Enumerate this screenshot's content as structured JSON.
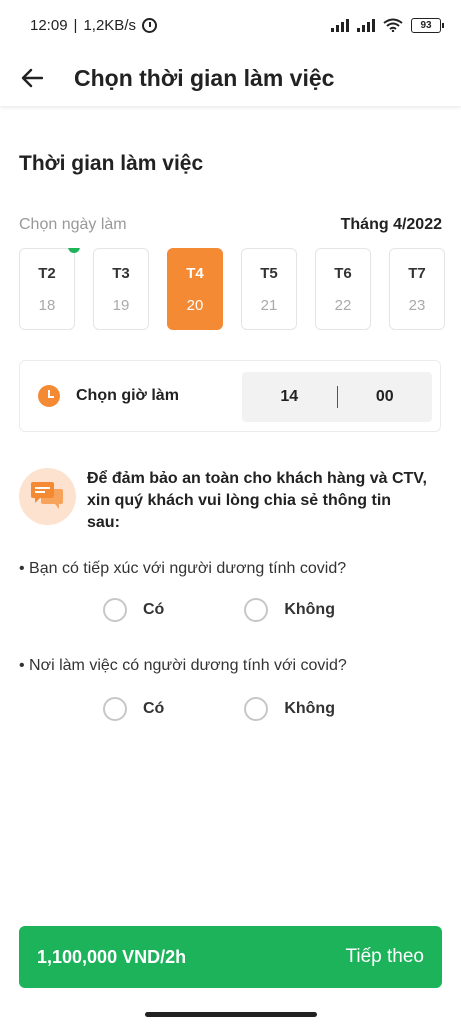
{
  "status_bar": {
    "time": "12:09",
    "network_speed": "1,2KB/s",
    "battery": "93"
  },
  "app_bar": {
    "title": "Chọn thời gian làm việc"
  },
  "work_time": {
    "section_title": "Thời gian làm việc",
    "choose_day_label": "Chọn ngày làm",
    "month": "Tháng 4/2022",
    "days": [
      {
        "name": "T2",
        "date": "18"
      },
      {
        "name": "T3",
        "date": "19"
      },
      {
        "name": "T4",
        "date": "20"
      },
      {
        "name": "T5",
        "date": "21"
      },
      {
        "name": "T6",
        "date": "22"
      },
      {
        "name": "T7",
        "date": "23"
      }
    ],
    "selected_day": "T4"
  },
  "time_picker": {
    "label": "Chọn giờ làm",
    "hour": "14",
    "minute": "00"
  },
  "notice": {
    "text": "Để đảm bảo an toàn cho khách hàng và CTV, xin quý khách vui lòng chia sẻ thông tin sau:"
  },
  "questions": [
    {
      "text": "• Bạn có tiếp xúc với người dương tính covid?",
      "yes": "Có",
      "no": "Không"
    },
    {
      "text": "• Nơi làm việc có người dương tính với covid?",
      "yes": "Có",
      "no": "Không"
    }
  ],
  "footer": {
    "price": "1,100,000 VND/2h",
    "next_label": "Tiếp theo"
  },
  "colors": {
    "accent_orange": "#f58a34",
    "primary_green": "#1cb35b"
  }
}
